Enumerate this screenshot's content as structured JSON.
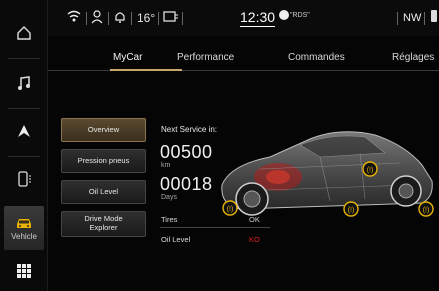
{
  "status_bar": {
    "temperature": "16°",
    "time": "12:30",
    "radio": "\"RDS\"",
    "network": "NW"
  },
  "sidebar": {
    "items": [
      {
        "name": "home",
        "icon": "home-icon"
      },
      {
        "name": "media",
        "icon": "music-note-icon"
      },
      {
        "name": "navigation",
        "icon": "navigation-arrow-icon"
      },
      {
        "name": "phone",
        "icon": "phone-icon"
      },
      {
        "name": "vehicle",
        "icon": "car-icon",
        "label": "Vehicle",
        "active": true
      },
      {
        "name": "apps",
        "icon": "grid-icon"
      }
    ]
  },
  "tabs": [
    {
      "label": "MyCar",
      "active": true
    },
    {
      "label": "Performance"
    },
    {
      "label": "Commandes"
    },
    {
      "label": "Réglages"
    }
  ],
  "menu": {
    "overview": "Overview",
    "tire_pressure": "Pression pneus",
    "oil_level": "Oil Level",
    "drive_mode": "Drive Mode Explorer"
  },
  "service": {
    "title": "Next Service in:",
    "distance_value": "00500",
    "distance_unit": "km",
    "days_value": "00018",
    "days_unit": "Days"
  },
  "status_rows": {
    "tires_label": "Tires",
    "tires_value": "OK",
    "oil_label": "Oil Level",
    "oil_value": "KO"
  },
  "colors": {
    "accent": "#c8a86a",
    "ok": "#cfcfcf",
    "ko": "#e0201f",
    "tire_badge": "#e8b400"
  }
}
